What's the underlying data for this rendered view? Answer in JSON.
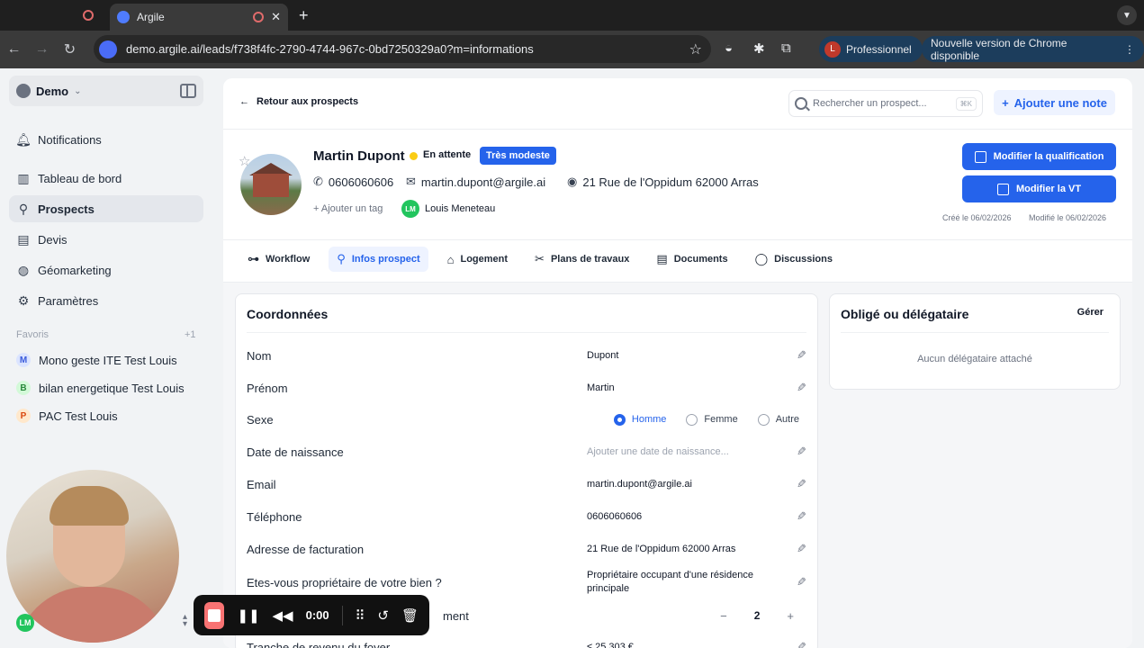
{
  "browser": {
    "tab_title": "Argile",
    "url": "demo.argile.ai/leads/f738f4fc-2790-4744-967c-0bd7250329a0?m=informations",
    "profile_initial": "L",
    "profile_label": "Professionnel",
    "update_label": "Nouvelle version de Chrome disponible"
  },
  "sidebar": {
    "workspace": "Demo",
    "items": [
      {
        "label": "Notifications",
        "icon": "bell-icon"
      },
      {
        "label": "Tableau de bord",
        "icon": "dashboard-icon"
      },
      {
        "label": "Prospects",
        "icon": "prospects-icon",
        "active": true
      },
      {
        "label": "Devis",
        "icon": "document-icon"
      },
      {
        "label": "Géomarketing",
        "icon": "globe-icon"
      },
      {
        "label": "Paramètres",
        "icon": "gear-icon"
      }
    ],
    "favorites_label": "Favoris",
    "favorites_count": "+1",
    "favorites": [
      {
        "letter": "M",
        "label": "Mono geste ITE Test Louis",
        "color": "#dbe4ff",
        "text_color": "#3b5bdb"
      },
      {
        "letter": "B",
        "label": "bilan energetique Test Louis",
        "color": "#d3f9d8",
        "text_color": "#2b8a3e"
      },
      {
        "letter": "P",
        "label": "PAC Test Louis",
        "color": "#ffe8cc",
        "text_color": "#d9480f"
      }
    ],
    "user_initials": "LM"
  },
  "header": {
    "back_label": "Retour aux prospects",
    "search_placeholder": "Rechercher un prospect...",
    "search_shortcut": "⌘K",
    "add_note_label": "Ajouter une note"
  },
  "lead": {
    "name": "Martin Dupont",
    "status": "En attente",
    "badge": "Très modeste",
    "phone": "0606060606",
    "email": "martin.dupont@argile.ai",
    "address": "21 Rue de l'Oppidum 62000 Arras",
    "add_tag": "+ Ajouter un tag",
    "owner_initials": "LM",
    "owner_name": "Louis Meneteau",
    "btn_qualification": "Modifier la qualification",
    "btn_vt": "Modifier la VT",
    "created": "Créé le 06/02/2026",
    "modified": "Modifié le 06/02/2026"
  },
  "tabs": [
    {
      "label": "Workflow",
      "icon": "workflow-icon"
    },
    {
      "label": "Infos prospect",
      "icon": "prospect-icon",
      "active": true
    },
    {
      "label": "Logement",
      "icon": "house-icon"
    },
    {
      "label": "Plans de travaux",
      "icon": "tools-icon"
    },
    {
      "label": "Documents",
      "icon": "document-icon"
    },
    {
      "label": "Discussions",
      "icon": "chat-icon"
    }
  ],
  "coordonnees": {
    "title": "Coordonnées",
    "rows": {
      "nom": {
        "label": "Nom",
        "value": "Dupont"
      },
      "prenom": {
        "label": "Prénom",
        "value": "Martin"
      },
      "sexe": {
        "label": "Sexe",
        "options": [
          "Homme",
          "Femme",
          "Autre"
        ],
        "selected": "Homme"
      },
      "naissance": {
        "label": "Date de naissance",
        "placeholder": "Ajouter une date de naissance..."
      },
      "email": {
        "label": "Email",
        "value": "martin.dupont@argile.ai"
      },
      "telephone": {
        "label": "Téléphone",
        "value": "0606060606"
      },
      "adresse": {
        "label": "Adresse de facturation",
        "value": "21 Rue de l'Oppidum 62000 Arras"
      },
      "proprietaire": {
        "label": "Etes-vous propriétaire de votre bien ?",
        "value": "Propriétaire occupant d'une résidence principale"
      },
      "foyer": {
        "label_visible": "ment",
        "value": "2"
      },
      "revenu": {
        "label": "Tranche de revenu du foyer",
        "value": "≤ 25 303 €"
      }
    }
  },
  "oblige": {
    "title": "Obligé ou délégataire",
    "manage_label": "Gérer",
    "empty": "Aucun délégataire attaché"
  },
  "recorder": {
    "time": "0:00"
  }
}
